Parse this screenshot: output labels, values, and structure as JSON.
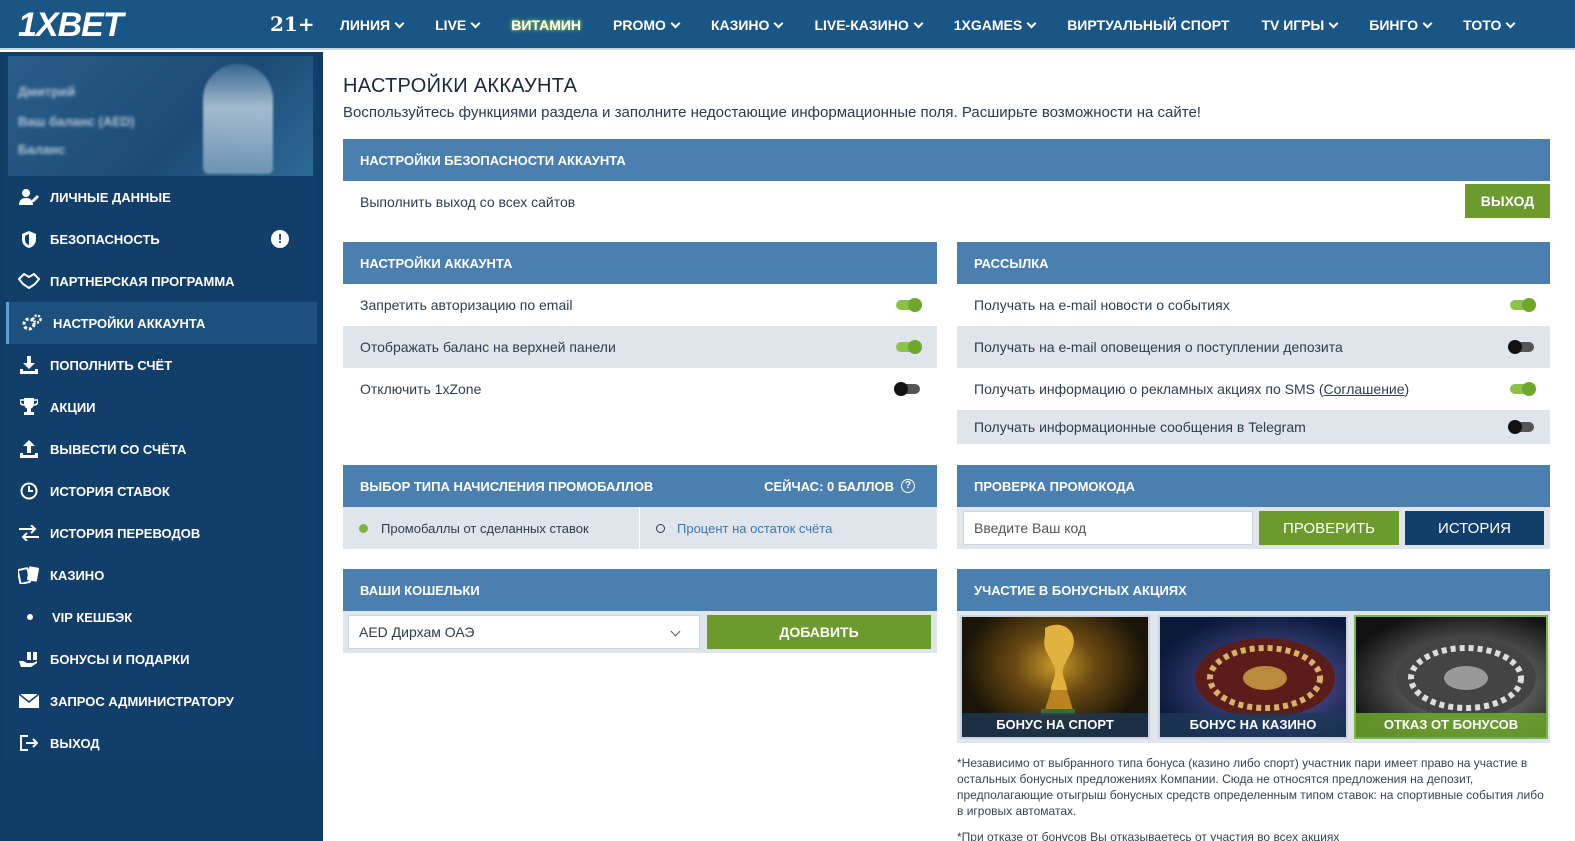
{
  "header": {
    "logo": "1XBET",
    "age": "21+",
    "nav": [
      {
        "label": "ЛИНИЯ",
        "chevron": true
      },
      {
        "label": "LIVE",
        "chevron": true
      },
      {
        "label": "ВИТАМИН",
        "chevron": false,
        "highlight": true
      },
      {
        "label": "PROMO",
        "chevron": true
      },
      {
        "label": "КАЗИНО",
        "chevron": true
      },
      {
        "label": "LIVE-КАЗИНО",
        "chevron": true
      },
      {
        "label": "1XGAMES",
        "chevron": true
      },
      {
        "label": "ВИРТУАЛЬНЫЙ СПОРТ",
        "chevron": false
      },
      {
        "label": "TV ИГРЫ",
        "chevron": true
      },
      {
        "label": "БИНГО",
        "chevron": true
      },
      {
        "label": "ТОТО",
        "chevron": true
      }
    ]
  },
  "profile": {
    "line1": "Дмитрий",
    "line2": "Ваш баланс (AED)",
    "line3": "Баланс"
  },
  "sidebar": {
    "items": [
      {
        "label": "ЛИЧНЫЕ ДАННЫЕ",
        "icon": "user-edit-icon"
      },
      {
        "label": "БЕЗОПАСНОСТЬ",
        "icon": "shield-icon",
        "warning": "!"
      },
      {
        "label": "ПАРТНЕРСКАЯ ПРОГРАММА",
        "icon": "handshake-icon"
      },
      {
        "label": "НАСТРОЙКИ АККАУНТА",
        "icon": "gears-icon",
        "active": true
      },
      {
        "label": "ПОПОЛНИТЬ СЧЁТ",
        "icon": "download-icon"
      },
      {
        "label": "АКЦИИ",
        "icon": "trophy-icon"
      },
      {
        "label": "ВЫВЕСТИ СО СЧЁТА",
        "icon": "upload-icon"
      },
      {
        "label": "ИСТОРИЯ СТАВОК",
        "icon": "clock-icon"
      },
      {
        "label": "ИСТОРИЯ ПЕРЕВОДОВ",
        "icon": "transfer-icon"
      },
      {
        "label": "КАЗИНО",
        "icon": "cards-icon"
      },
      {
        "label": "VIP КЕШБЭК",
        "icon": "dot-icon"
      },
      {
        "label": "БОНУСЫ И ПОДАРКИ",
        "icon": "gift-hand-icon"
      },
      {
        "label": "ЗАПРОС АДМИНИСТРАТОРУ",
        "icon": "envelope-icon"
      },
      {
        "label": "ВЫХОД",
        "icon": "logout-icon"
      }
    ]
  },
  "main": {
    "title": "НАСТРОЙКИ АККАУНТА",
    "subtitle": "Воспользуйтесь функциями раздела и заполните недостающие информационные поля. Расширьте возможности на сайте!",
    "security": {
      "header": "НАСТРОЙКИ БЕЗОПАСНОСТИ АККАУНТА",
      "row": "Выполнить выход со всех сайтов",
      "button": "ВЫХОД"
    },
    "account": {
      "header": "НАСТРОЙКИ АККАУНТА",
      "rows": [
        {
          "label": "Запретить авторизацию по email",
          "on": true
        },
        {
          "label": "Отображать баланс на верхней панели",
          "on": true
        },
        {
          "label": "Отключить 1xZone",
          "on": false
        }
      ]
    },
    "mailing": {
      "header": "РАССЫЛКА",
      "rows": [
        {
          "label": "Получать на e-mail новости о событиях",
          "on": true
        },
        {
          "label": "Получать на e-mail оповещения о поступлении депозита",
          "on": false
        },
        {
          "label": "Получать информацию о рекламных акциях по SMS (",
          "link": "Соглашение",
          "after": ")",
          "on": true
        },
        {
          "label": "Получать информационные сообщения в Telegram",
          "on": false
        }
      ]
    },
    "promopoints": {
      "header": "ВЫБОР ТИПА НАЧИСЛЕНИЯ ПРОМОБАЛЛОВ",
      "now": "СЕЙЧАС: 0 БАЛЛОВ",
      "option1": "Промобаллы от сделанных ставок",
      "option2": "Процент на остаток счёта"
    },
    "promocode": {
      "header": "ПРОВЕРКА ПРОМОКОДА",
      "placeholder": "Введите Ваш код",
      "check": "ПРОВЕРИТЬ",
      "history": "ИСТОРИЯ"
    },
    "wallets": {
      "header": "ВАШИ КОШЕЛЬКИ",
      "selected": "AED Дирхам ОАЭ",
      "add": "ДОБАВИТЬ"
    },
    "bonus": {
      "header": "УЧАСТИЕ В БОНУСНЫХ АКЦИЯХ",
      "cards": [
        "БОНУС НА СПОРТ",
        "БОНУС НА КАЗИНО",
        "ОТКАЗ ОТ БОНУСОВ"
      ],
      "note": "*Независимо от выбранного типа бонуса (казино либо спорт) участник пари имеет право на участие в остальных бонусных предложениях Компании. Сюда не относятся предложения на депозит, предполагающие отыгрыш бонусных средств определенным типом ставок: на спортивные события либо в игровых автоматах.",
      "note2": "*При отказе от бонусов Вы отказываетесь от участия во всех акциях"
    }
  }
}
